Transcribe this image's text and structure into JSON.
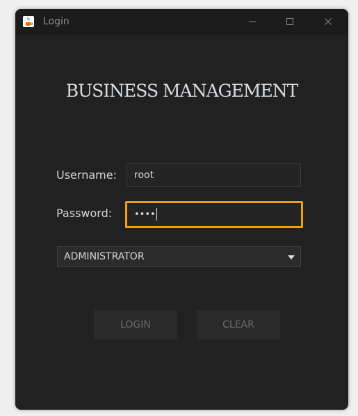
{
  "window": {
    "title": "Login",
    "icon": "java-cup-icon",
    "controls": [
      "minimize-icon",
      "maximize-icon",
      "close-icon"
    ]
  },
  "heading": "BUSINESS MANAGEMENT",
  "form": {
    "username_label": "Username:",
    "username_value": "root",
    "password_label": "Password:",
    "password_value": "••••",
    "role_selected": "ADMINISTRATOR"
  },
  "buttons": {
    "login": "LOGIN",
    "clear": "CLEAR"
  },
  "colors": {
    "focus_border": "#f0a00f",
    "background": "#212121"
  }
}
